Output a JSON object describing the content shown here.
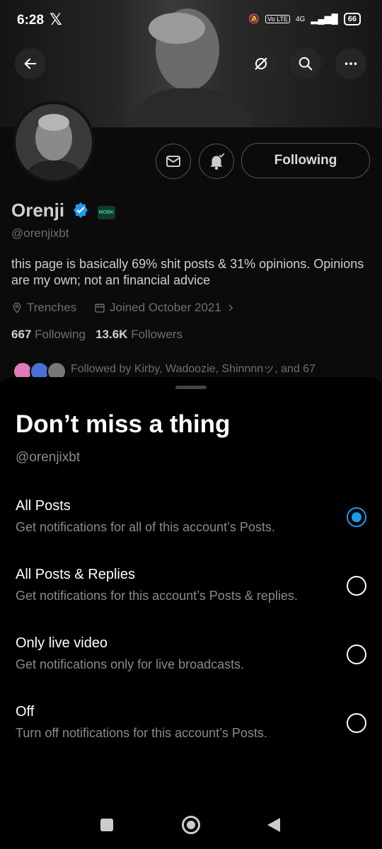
{
  "status_bar": {
    "time": "6:28",
    "network": "4G",
    "volte": "Vo LTE",
    "battery": "66"
  },
  "profile": {
    "name": "Orenji",
    "verified": true,
    "affiliate_badge": "MOBK",
    "handle": "@orenjixbt",
    "bio": "this page is basically 69% shit posts & 31% opinions. Opinions are my own; not an financial advice",
    "location": "Trenches",
    "joined": "Joined October 2021",
    "following_count": "667",
    "following_label": "Following",
    "followers_count": "13.6K",
    "followers_label": "Followers",
    "followed_by": "Followed by Kirby, Wadoozie, Shinnnnッ, and 67",
    "follow_button": "Following"
  },
  "sheet": {
    "title": "Don’t miss a thing",
    "handle": "@orenjixbt",
    "options": [
      {
        "title": "All Posts",
        "desc": "Get notifications for all of this account’s Posts.",
        "selected": true
      },
      {
        "title": "All Posts & Replies",
        "desc": "Get notifications for this account’s Posts & replies.",
        "selected": false
      },
      {
        "title": "Only live video",
        "desc": "Get notifications only for live broadcasts.",
        "selected": false
      },
      {
        "title": "Off",
        "desc": "Turn off notifications for this account’s Posts.",
        "selected": false
      }
    ]
  },
  "colors": {
    "accent": "#1d9bf0",
    "background": "#000000",
    "secondary_text": "#8a8a8a"
  },
  "icons": [
    "back-arrow-icon",
    "no-sync-icon",
    "search-icon",
    "more-icon",
    "mail-icon",
    "bell-check-icon",
    "verified-icon",
    "location-icon",
    "calendar-icon",
    "chevron-right-icon",
    "recents-icon",
    "home-icon",
    "back-icon"
  ]
}
